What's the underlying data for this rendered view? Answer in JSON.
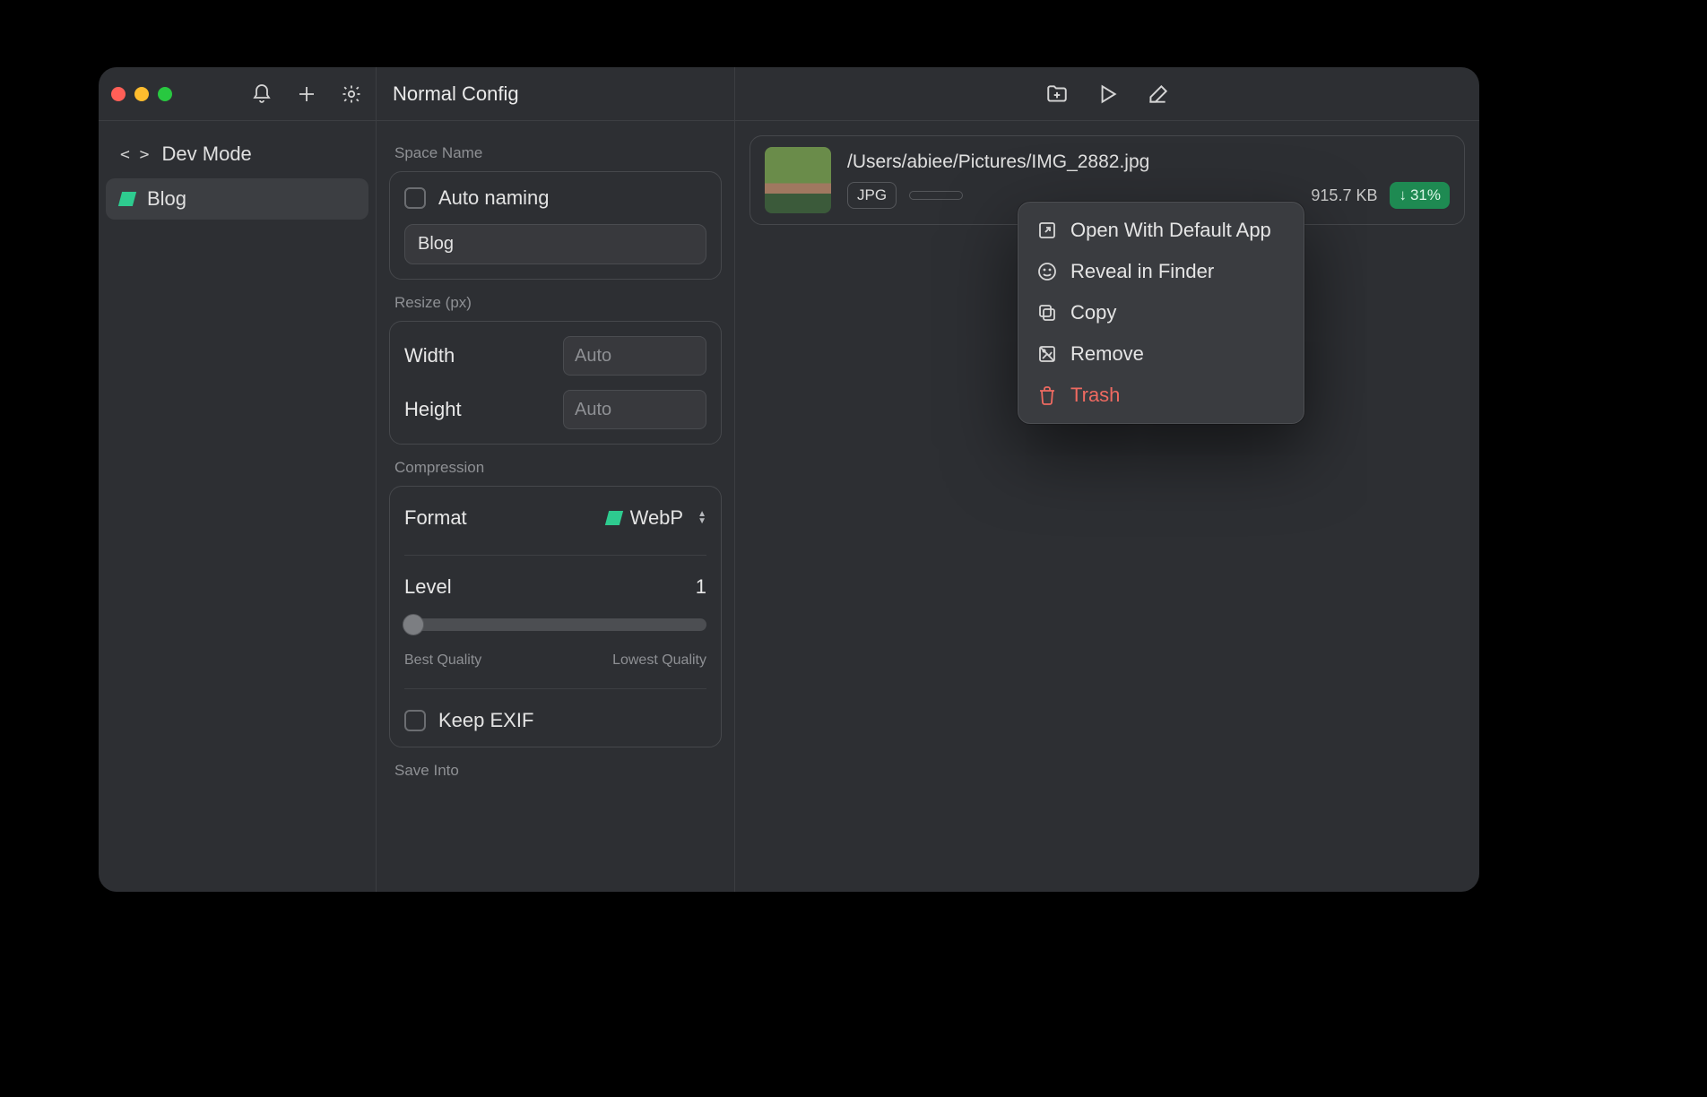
{
  "sidebar": {
    "items": [
      {
        "label": "Dev Mode"
      },
      {
        "label": "Blog"
      }
    ]
  },
  "config": {
    "title": "Normal Config",
    "space_name_section": "Space Name",
    "auto_naming_label": "Auto naming",
    "space_name_value": "Blog",
    "resize_section": "Resize (px)",
    "width_label": "Width",
    "height_label": "Height",
    "width_placeholder": "Auto",
    "height_placeholder": "Auto",
    "compression_section": "Compression",
    "format_label": "Format",
    "format_value": "WebP",
    "level_label": "Level",
    "level_value": "1",
    "best_quality": "Best Quality",
    "lowest_quality": "Lowest Quality",
    "keep_exif_label": "Keep EXIF",
    "save_into_section": "Save Into"
  },
  "file": {
    "path": "/Users/abiee/Pictures/IMG_2882.jpg",
    "format_from": "JPG",
    "size_after": "915.7 KB",
    "savings": "31%"
  },
  "context_menu": {
    "open": "Open With Default App",
    "reveal": "Reveal in Finder",
    "copy": "Copy",
    "remove": "Remove",
    "trash": "Trash"
  }
}
